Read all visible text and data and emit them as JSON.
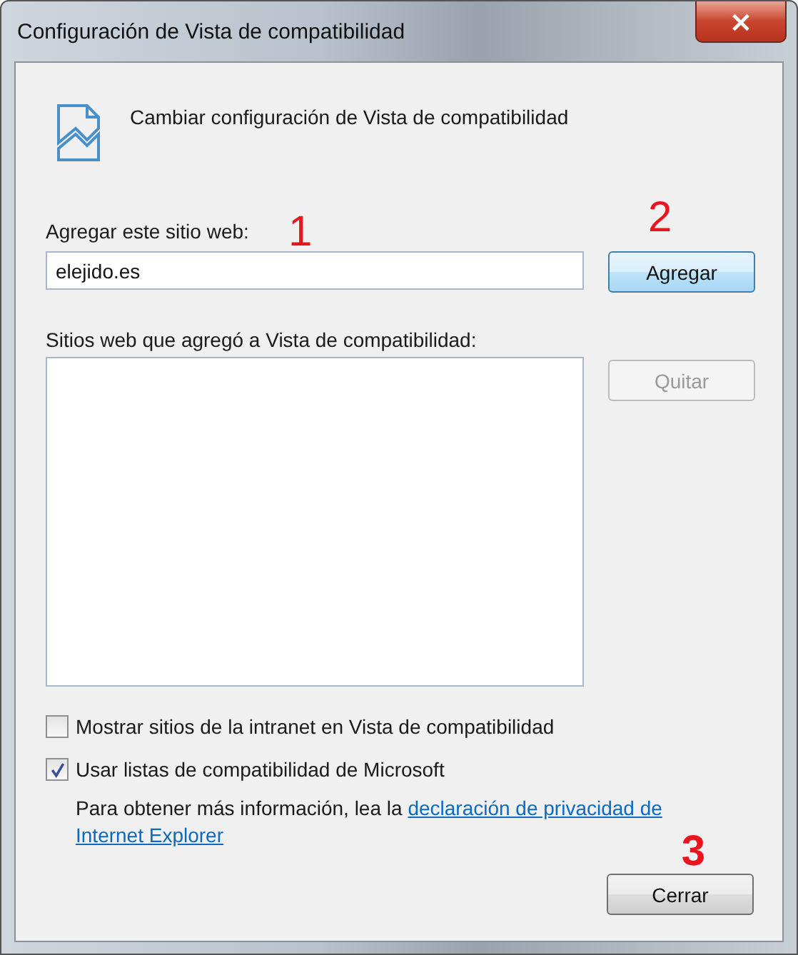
{
  "window": {
    "title": "Configuración de Vista de compatibilidad",
    "close": "×"
  },
  "heading": "Cambiar configuración de Vista de compatibilidad",
  "add_site": {
    "label": "Agregar este sitio web:",
    "value": "elejido.es",
    "button": "Agregar"
  },
  "added_sites": {
    "label": "Sitios web que agregó a Vista de compatibilidad:",
    "button": {
      "label": "Quitar",
      "disabled": true
    }
  },
  "options": [
    {
      "label": "Mostrar sitios de la intranet en Vista de compatibilidad",
      "checked": false
    },
    {
      "label": "Usar listas de compatibilidad de Microsoft",
      "checked": true
    }
  ],
  "info": {
    "text": "Para obtener más información, lea la",
    "link_lines": [
      "declaración de privacidad de",
      "Internet Explorer"
    ]
  },
  "close_button": "Cerrar",
  "annotations": [
    "1",
    "2",
    "3"
  ]
}
